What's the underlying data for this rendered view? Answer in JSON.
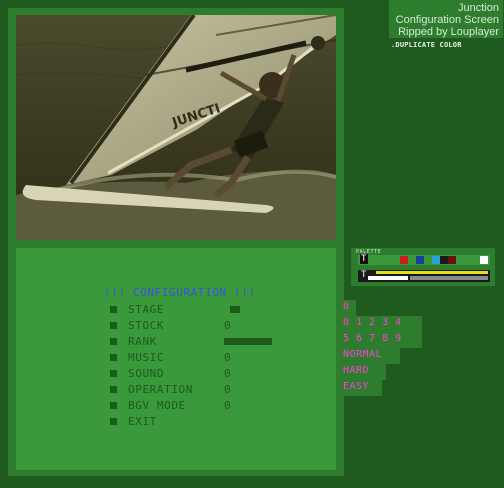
{
  "credits": {
    "title": "Junction",
    "subtitle": "Configuration Screen",
    "ripper": "Ripped by Louplayer",
    "note": ".DUPLICATE COLOR"
  },
  "photo": {
    "sail_text": "JUNCTI",
    "image": "windsurfer-photo"
  },
  "menu": {
    "title": "!!! CONFIGURATION !!!",
    "items": [
      {
        "label": "STAGE",
        "value": ""
      },
      {
        "label": "STOCK",
        "value": "0"
      },
      {
        "label": "RANK",
        "value": ""
      },
      {
        "label": "MUSIC",
        "value": "0"
      },
      {
        "label": "SOUND",
        "value": "0"
      },
      {
        "label": "OPERATION",
        "value": "0"
      },
      {
        "label": "BGV MODE",
        "value": "0"
      },
      {
        "label": "EXIT",
        "value": ""
      }
    ]
  },
  "palette": {
    "label": "PALETTE",
    "row1_marker": "T",
    "row2_marker": "T",
    "colors": [
      "#2e7d2e",
      "#c8201e",
      "#1b3f9e",
      "#2aa4d8",
      "#1a1a1a",
      "#6b0f0f",
      "#ffffff",
      "#e0e020",
      "#8a8a8a"
    ]
  },
  "options": {
    "stage_value": "0",
    "digits_row1": "0 1 2 3 4",
    "digits_row2": "5 6 7 8 9",
    "rank_normal": "NORMAL",
    "rank_hard": "HARD",
    "rank_easy": "EASY"
  }
}
